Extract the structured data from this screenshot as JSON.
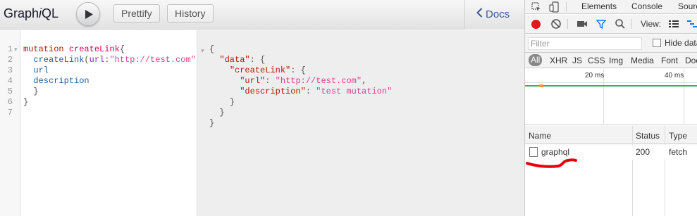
{
  "graphiql": {
    "title_prefix": "Graph",
    "title_italic": "i",
    "title_suffix": "QL",
    "prettify_label": "Prettify",
    "history_label": "History",
    "docs_label": "Docs",
    "line_numbers": [
      "1",
      "2",
      "3",
      "4",
      "5",
      "6",
      "7"
    ],
    "query": {
      "l1_kw": "mutation",
      "l1_name": "createLink",
      "l1_brace": "{",
      "l2_field": "createLink",
      "l2_arg": "url",
      "l2_value": "\"http://test.com\"",
      "l3_field": "url",
      "l4_field": "description",
      "l5_close": "}",
      "l6_close": "}"
    },
    "result": {
      "open": "{",
      "data_key": "\"data\"",
      "create_key": "\"createLink\"",
      "url_key": "\"url\"",
      "url_value": "\"http://test.com\"",
      "desc_key": "\"description\"",
      "desc_value": "\"test mutation\""
    }
  },
  "devtools": {
    "tabs": [
      "Elements",
      "Console",
      "Sources"
    ],
    "view_label": "View:",
    "filter_placeholder": "Filter",
    "hide_data_label": "Hide data URLs",
    "types": [
      "All",
      "XHR",
      "JS",
      "CSS",
      "Img",
      "Media",
      "Font",
      "Doc"
    ],
    "timeline_labels": [
      "20 ms",
      "40 ms"
    ],
    "columns": [
      "Name",
      "Status",
      "Type"
    ],
    "rows": [
      {
        "name": "graphql",
        "status": "200",
        "type": "fetch"
      }
    ],
    "colors": {
      "record": "#e31a1c",
      "timeline_bar": "#3bb64a",
      "annotation": "#e8000b"
    }
  }
}
